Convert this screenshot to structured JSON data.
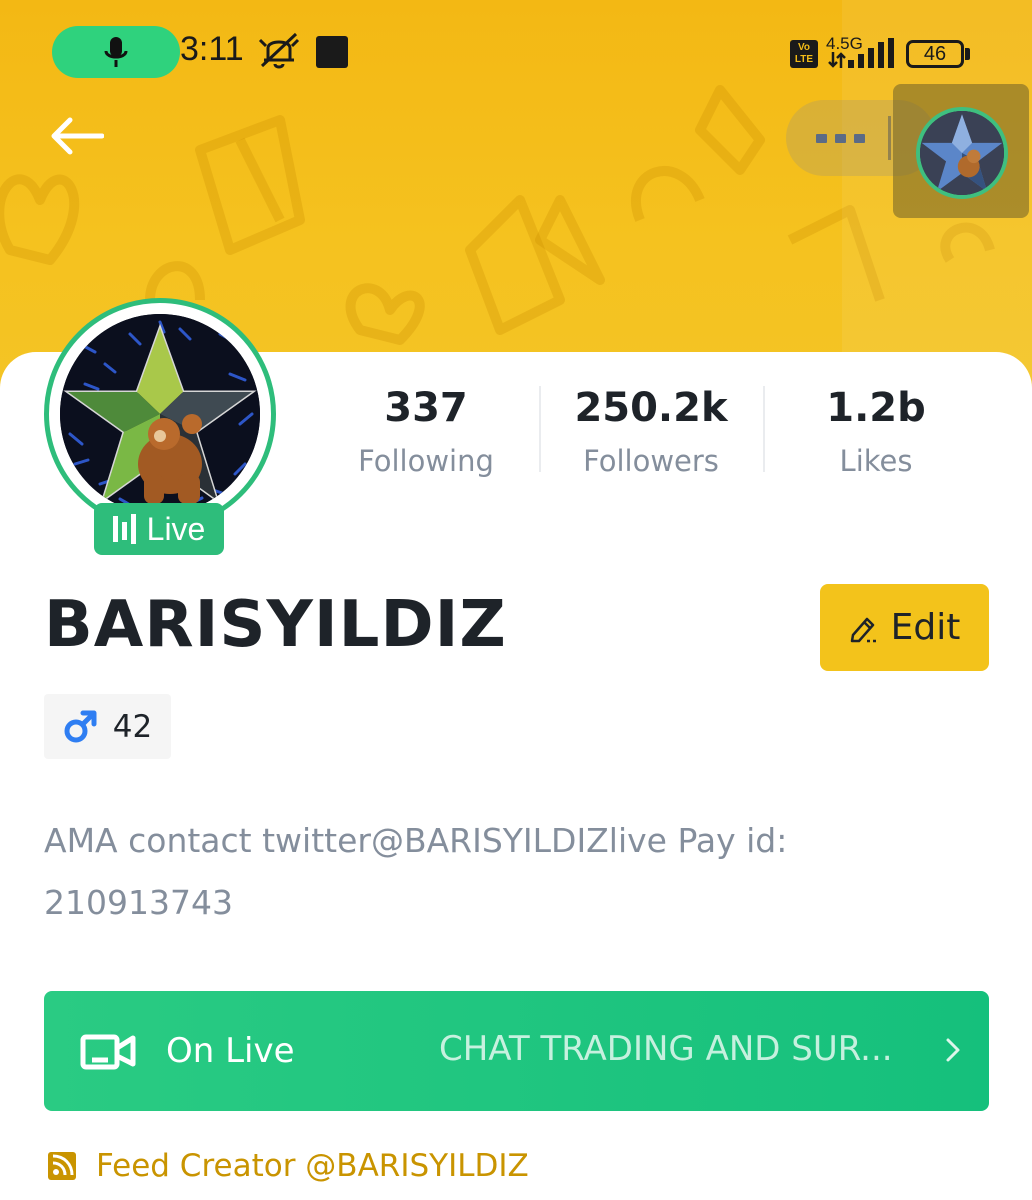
{
  "status_bar": {
    "time": "3:11",
    "network_type": "4.5G",
    "volte": "Vo LTE",
    "battery": "46"
  },
  "header": {
    "back_icon": "arrow-left-icon",
    "more_icon": "more-horizontal-icon",
    "avatar_icon": "profile-avatar"
  },
  "profile": {
    "live_badge": "Live",
    "username": "BARISYILDIZ",
    "edit_label": "Edit",
    "gender_icon": "male-symbol-icon",
    "age": "42",
    "bio": "AMA contact twitter@BARISYILDIZlive Pay id: 210913743"
  },
  "stats": [
    {
      "value": "337",
      "label": "Following"
    },
    {
      "value": "250.2k",
      "label": "Followers"
    },
    {
      "value": "1.2b",
      "label": "Likes"
    }
  ],
  "live_bar": {
    "label": "On Live",
    "title": "CHAT TRADING AND SUR..."
  },
  "feed": {
    "label": "Feed Creator @BARISYILDIZ"
  },
  "colors": {
    "banner": "#f3b814",
    "accent_green": "#2ebd7b",
    "edit_yellow": "#f3c31b",
    "feed_gold": "#c99400",
    "text_primary": "#1e2329",
    "text_secondary": "#848e9c"
  }
}
